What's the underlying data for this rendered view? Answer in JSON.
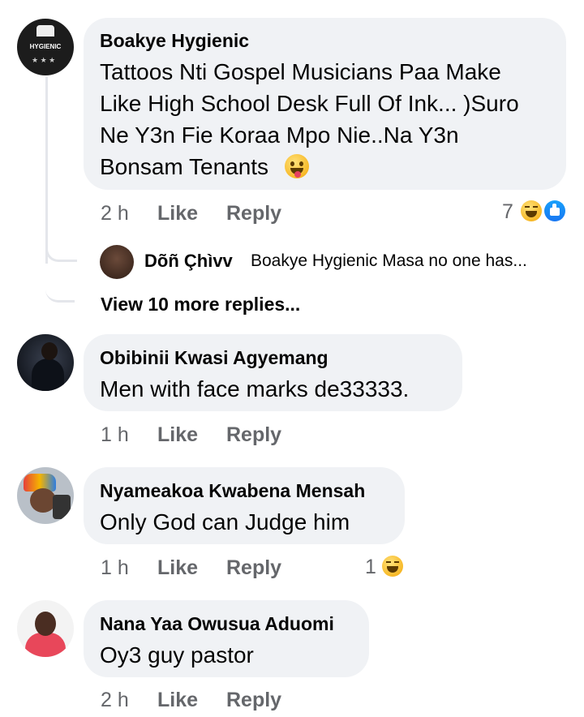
{
  "comments": [
    {
      "author": "Boakye Hygienic",
      "lines": [
        "Tattoos Nti Gospel Musicians Paa Make",
        "Like High School Desk Full Of Ink... )Suro",
        "Ne Y3n Fie Koraa Mpo Nie..Na Y3n",
        "Bonsam Tenants"
      ],
      "time": "2 h",
      "like": "Like",
      "reply": "Reply",
      "reactions": "7",
      "avatar_text": "HYGIENIC",
      "reply_preview": {
        "author": "Dõñ Çhìvv",
        "text": "Boakye Hygienic Masa no one has..."
      },
      "view_more": "View 10 more replies..."
    },
    {
      "author": "Obibinii Kwasi Agyemang",
      "lines": [
        "Men with face marks de33333."
      ],
      "time": "1 h",
      "like": "Like",
      "reply": "Reply"
    },
    {
      "author": "Nyameakoa Kwabena Mensah",
      "lines": [
        "Only God can Judge him"
      ],
      "time": "1 h",
      "like": "Like",
      "reply": "Reply",
      "reactions": "1"
    },
    {
      "author": "Nana Yaa Owusua Aduomi",
      "lines": [
        "Oy3 guy pastor"
      ],
      "time": "2 h",
      "like": "Like",
      "reply": "Reply"
    }
  ],
  "colors": {
    "bubble": "#f0f2f5",
    "meta": "#65676b",
    "like_blue": "#1877f2",
    "haha_yellow": "#f7b928"
  }
}
